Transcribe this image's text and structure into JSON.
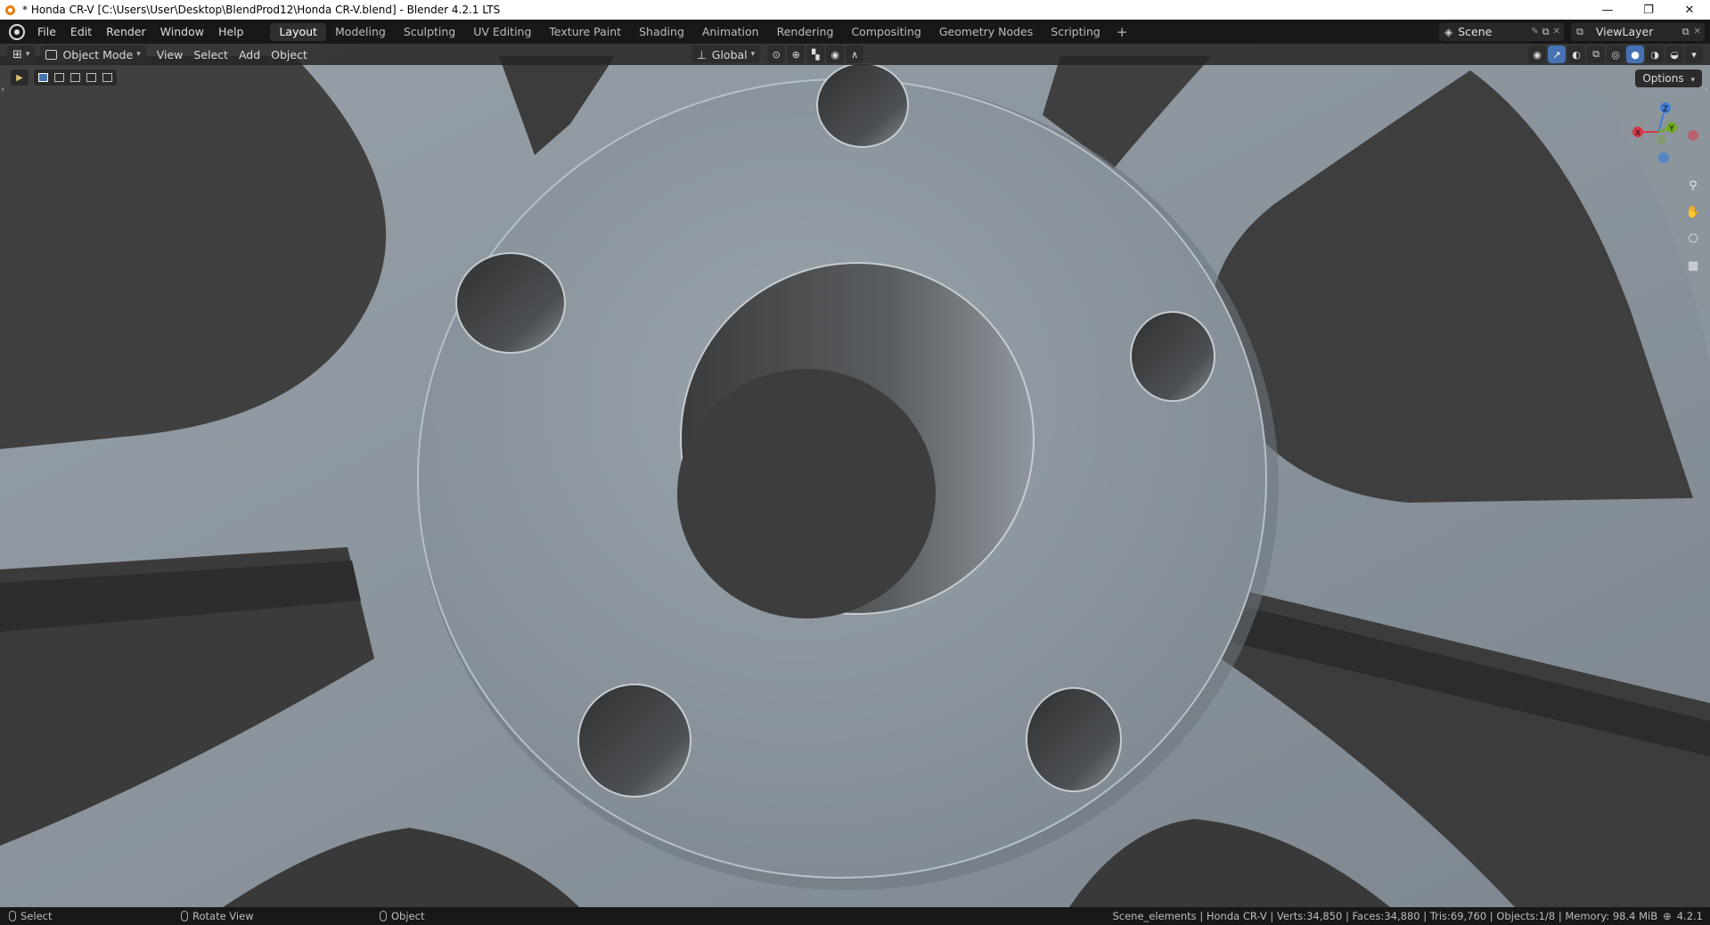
{
  "window": {
    "title": "* Honda CR-V [C:\\Users\\User\\Desktop\\BlendProd12\\Honda CR-V.blend] - Blender 4.2.1 LTS",
    "minimize": "—",
    "maximize": "❐",
    "close": "✕"
  },
  "topbar": {
    "menus": [
      "File",
      "Edit",
      "Render",
      "Window",
      "Help"
    ],
    "workspaces": [
      "Layout",
      "Modeling",
      "Sculpting",
      "UV Editing",
      "Texture Paint",
      "Shading",
      "Animation",
      "Rendering",
      "Compositing",
      "Geometry Nodes",
      "Scripting"
    ],
    "active_workspace": "Layout",
    "add_workspace": "+",
    "scene": "Scene",
    "view_layer": "ViewLayer"
  },
  "viewport_header": {
    "mode": "Object Mode",
    "menus": [
      "View",
      "Select",
      "Add",
      "Object"
    ],
    "orientation": "Global",
    "options": "Options"
  },
  "gizmo": {
    "x": "X",
    "y": "Y",
    "z": "Z"
  },
  "colors": {
    "x_axis": "#d8384a",
    "y_axis": "#72ad1f",
    "z_axis": "#3d7fd6",
    "accent": "#4772b3"
  },
  "statusbar": {
    "select": "Select",
    "rotate": "Rotate View",
    "object": "Object",
    "stats": "Scene_elements | Honda CR-V | Verts:34,850 | Faces:34,880 | Tris:69,760 | Objects:1/8 | Memory: 98.4 MiB",
    "version": "4.2.1"
  }
}
